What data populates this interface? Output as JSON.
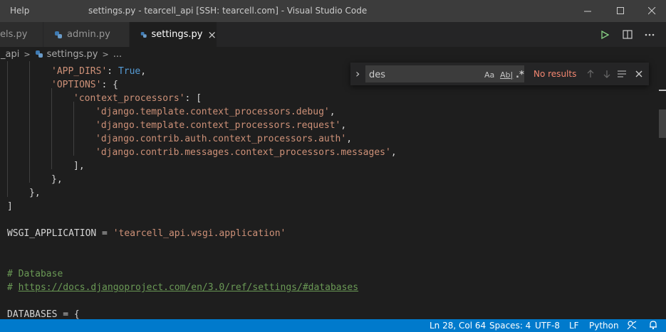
{
  "window": {
    "menu_help": "Help",
    "title": "settings.py - tearcell_api [SSH: tearcell.com] - Visual Studio Code"
  },
  "tabs": [
    {
      "label": "els.py",
      "active": false
    },
    {
      "label": "admin.py",
      "active": false
    },
    {
      "label": "settings.py",
      "active": true,
      "close": "×"
    }
  ],
  "breadcrumb": {
    "folder": "_api",
    "file": "settings.py",
    "more": "..."
  },
  "find_widget": {
    "toggle_glyph": "›",
    "query": "des",
    "match_case": "Aa",
    "whole_word": "Ab|",
    "regex": ".*",
    "result": "No results"
  },
  "code": {
    "app_dirs_key": "'APP_DIRS'",
    "app_dirs_sep": ": ",
    "app_dirs_val": "True",
    "app_dirs_end": ",",
    "options_key": "'OPTIONS'",
    "options_open": ": {",
    "cp_key": "'context_processors'",
    "cp_open": ": [",
    "cp_items": [
      "'django.template.context_processors.debug'",
      "'django.template.context_processors.request'",
      "'django.contrib.auth.context_processors.auth'",
      "'django.contrib.messages.context_processors.messages'"
    ],
    "comma": ",",
    "list_close": "],",
    "dict_close_inner": "},",
    "dict_close_outer": "},",
    "bracket_close": "]",
    "wsgi_name": "WSGI_APPLICATION",
    "wsgi_eq": " = ",
    "wsgi_val": "'tearcell_api.wsgi.application'",
    "db_comment": "# Database",
    "url_prefix": "# ",
    "url": "https://docs.djangoproject.com/en/3.0/ref/settings/#databases",
    "databases": "DATABASES = {"
  },
  "statusbar": {
    "position": "Ln 28, Col 64",
    "spaces": "Spaces: 4",
    "encoding": "UTF-8",
    "eol": "LF",
    "language": "Python"
  },
  "colors": {
    "accent": "#007acc",
    "string": "#ce9178",
    "keyword": "#569cd6",
    "comment": "#6a9955",
    "no_results": "#f48771"
  }
}
